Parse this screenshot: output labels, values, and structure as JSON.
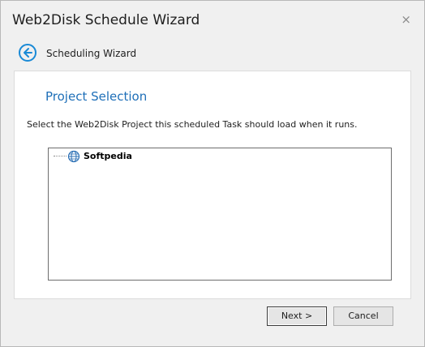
{
  "window": {
    "title": "Web2Disk Schedule Wizard",
    "close_glyph": "×"
  },
  "nav": {
    "label": "Scheduling Wizard",
    "back_icon": "back-arrow-icon"
  },
  "page": {
    "heading": "Project Selection",
    "description": "Select the Web2Disk Project this scheduled Task should load when it runs."
  },
  "tree": {
    "items": [
      {
        "label": "Softpedia",
        "icon": "globe-icon"
      }
    ]
  },
  "buttons": {
    "next": "Next >",
    "cancel": "Cancel"
  },
  "colors": {
    "accent": "#1a8ad6",
    "heading": "#1e6fb8"
  }
}
